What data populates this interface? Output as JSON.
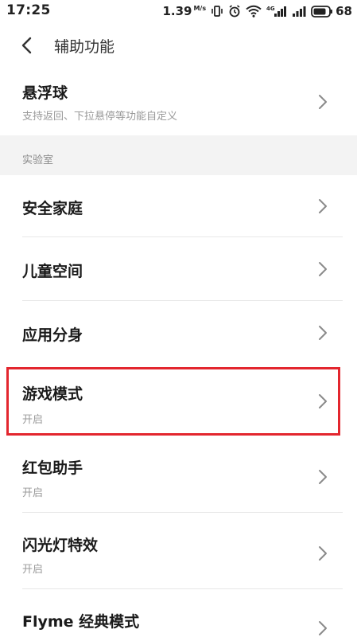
{
  "status_bar": {
    "time": "17:25",
    "net_speed": "1.39",
    "net_unit": "M/s",
    "battery_level": "68"
  },
  "header": {
    "title": "辅助功能"
  },
  "items": [
    {
      "title": "悬浮球",
      "subtitle": "支持返回、下拉悬停等功能自定义"
    },
    {
      "title": "安全家庭",
      "subtitle": ""
    },
    {
      "title": "儿童空间",
      "subtitle": ""
    },
    {
      "title": "应用分身",
      "subtitle": ""
    },
    {
      "title": "游戏模式",
      "subtitle": "开启"
    },
    {
      "title": "红包助手",
      "subtitle": "开启"
    },
    {
      "title": "闪光灯特效",
      "subtitle": "开启"
    },
    {
      "title": "Flyme 经典模式",
      "subtitle": ""
    }
  ],
  "section": {
    "label": "实验室"
  },
  "highlight": {
    "color": "#e3262e",
    "item_index": 4
  },
  "colors": {
    "background": "#ffffff",
    "section_background": "#f3f3f3",
    "secondary_text": "#9a9a9a"
  }
}
